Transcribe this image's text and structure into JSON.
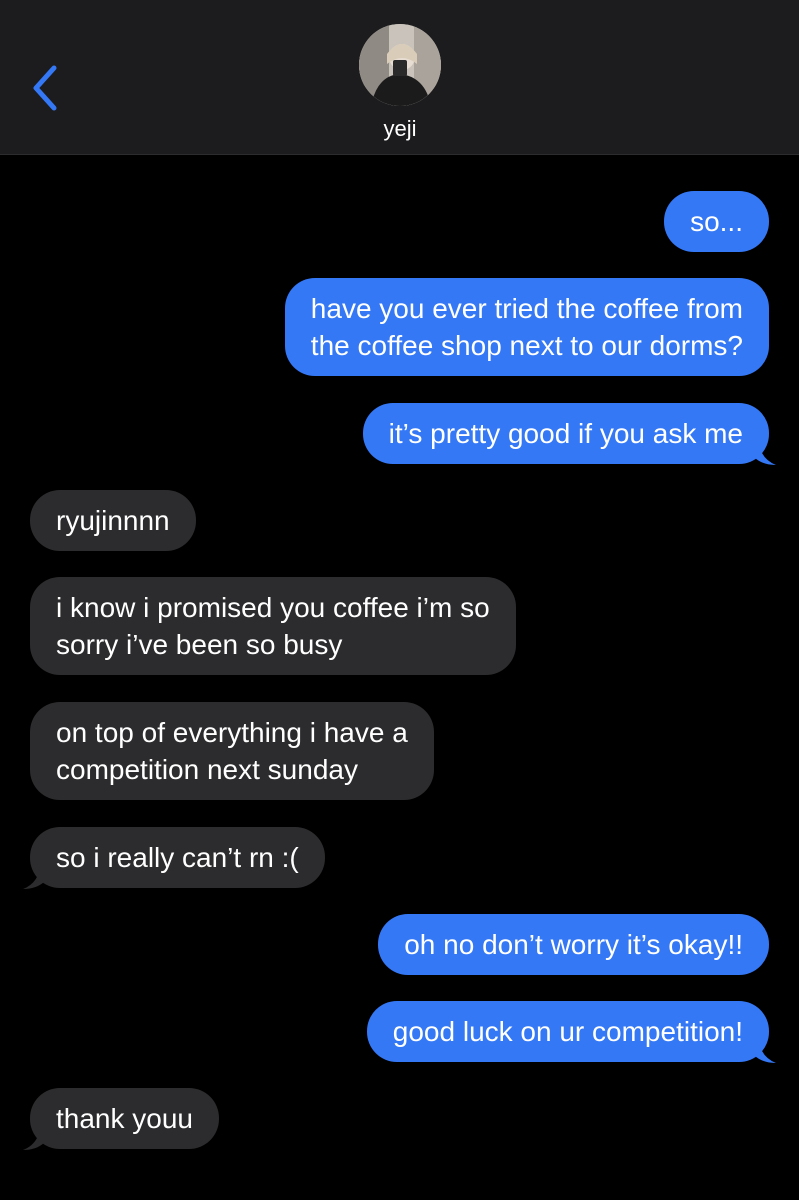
{
  "header": {
    "contact_name": "yeji",
    "back_icon": "chevron-left-icon",
    "accent_color": "#3478f6"
  },
  "messages": [
    {
      "direction": "sent",
      "lines": [
        "so..."
      ]
    },
    {
      "direction": "sent",
      "lines": [
        "have you ever tried the coffee from",
        "the coffee shop next to our dorms?"
      ]
    },
    {
      "direction": "sent",
      "lines": [
        "it’s pretty good if you ask me"
      ]
    },
    {
      "direction": "received",
      "lines": [
        "ryujinnnn"
      ]
    },
    {
      "direction": "received",
      "lines": [
        "i know i promised you coffee i’m so",
        "sorry i’ve been so busy"
      ]
    },
    {
      "direction": "received",
      "lines": [
        "on top of everything i have a",
        "competition next sunday"
      ]
    },
    {
      "direction": "received",
      "lines": [
        "so i really can’t rn :("
      ]
    },
    {
      "direction": "sent",
      "lines": [
        "oh no don’t worry it’s okay!!"
      ]
    },
    {
      "direction": "sent",
      "lines": [
        "good luck on ur competition!"
      ]
    },
    {
      "direction": "received",
      "lines": [
        "thank youu"
      ]
    }
  ],
  "colors": {
    "sent_bubble": "#3478f6",
    "received_bubble": "#2c2c2e",
    "header_bg": "#1c1c1e",
    "background": "#000000"
  }
}
